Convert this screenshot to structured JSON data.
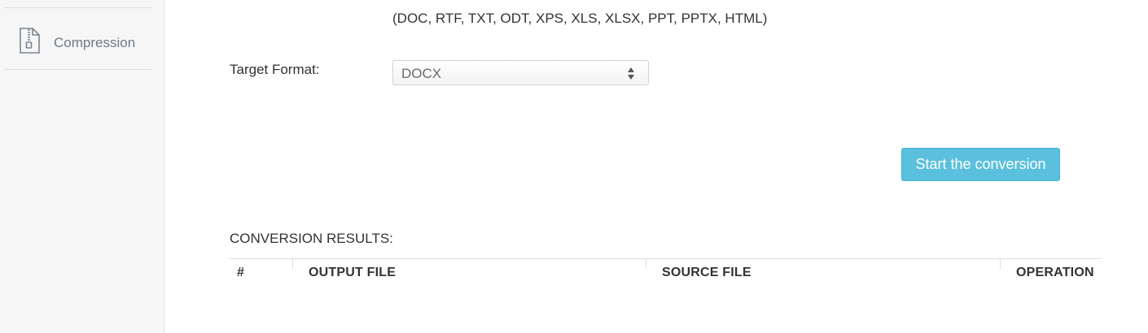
{
  "sidebar": {
    "items": [
      {
        "label": "Compression",
        "icon": "zip-file-icon"
      }
    ]
  },
  "formats_note": "(DOC, RTF, TXT, ODT, XPS, XLS, XLSX, PPT, PPTX, HTML)",
  "target_format": {
    "label": "Target Format:",
    "selected": "DOCX"
  },
  "start_button": {
    "label": "Start the conversion",
    "color": "#5bc0de"
  },
  "results": {
    "title": "CONVERSION RESULTS:",
    "columns": [
      "#",
      "OUTPUT FILE",
      "SOURCE FILE",
      "OPERATION"
    ],
    "rows": []
  }
}
